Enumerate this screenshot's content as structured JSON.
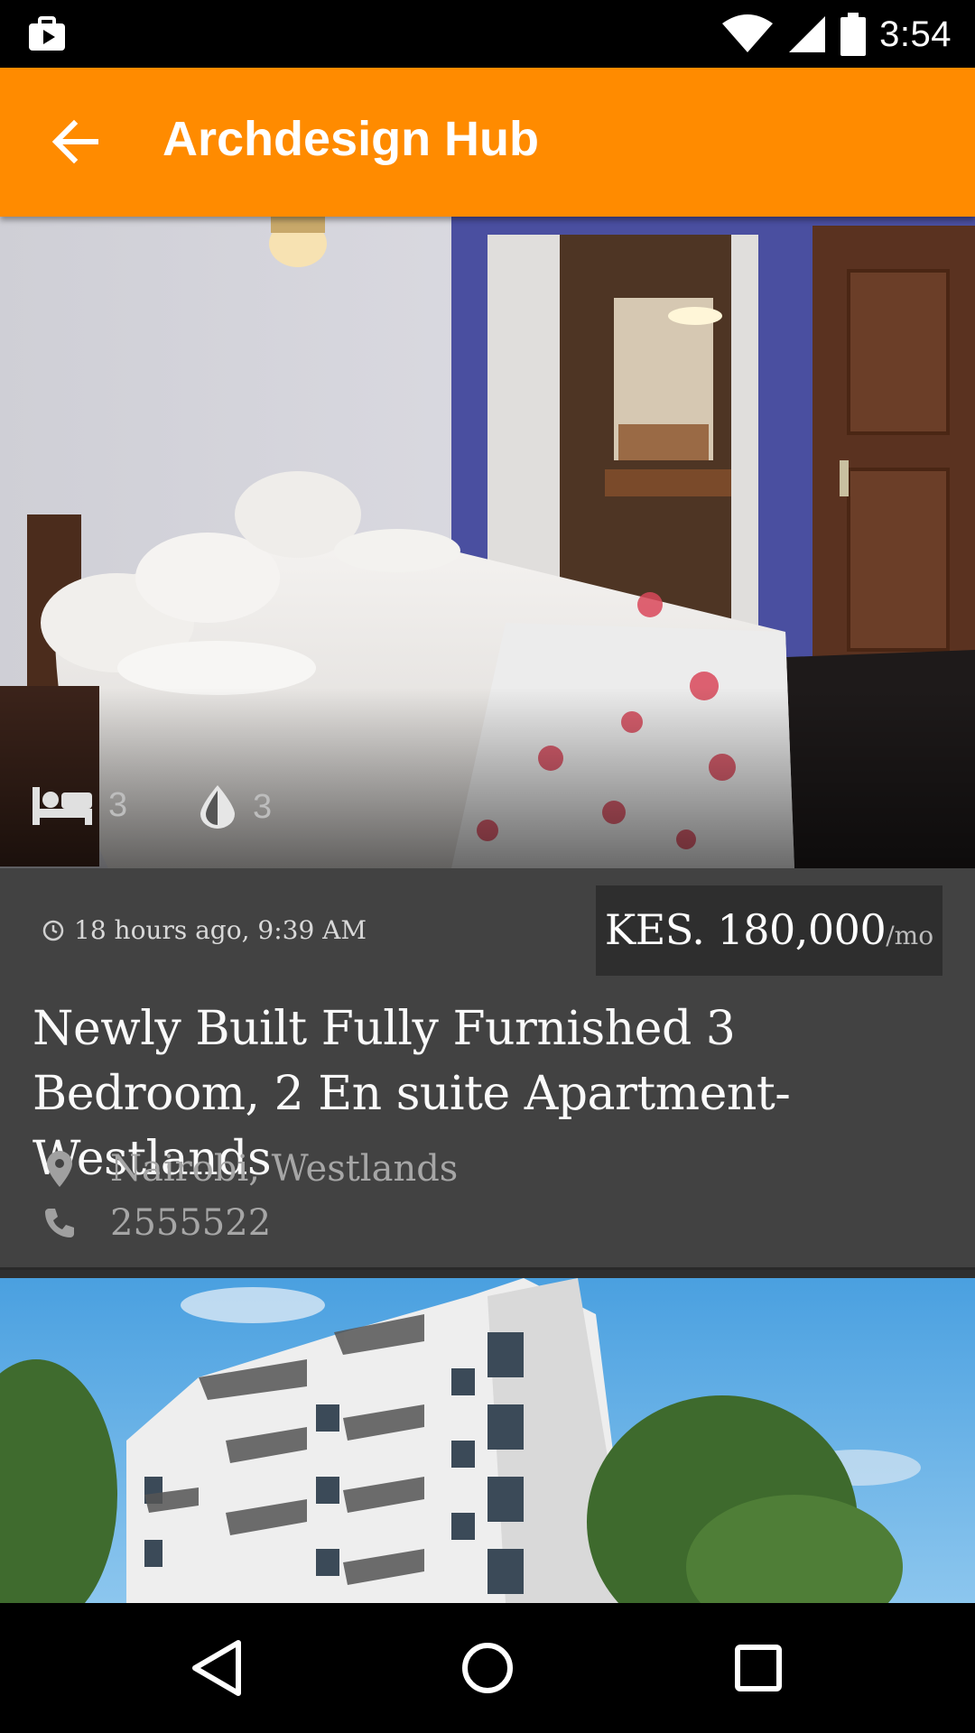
{
  "status_bar": {
    "time": "3:54",
    "icons": [
      "briefcase-play-icon",
      "wifi-icon",
      "cell-signal-icon",
      "battery-icon"
    ]
  },
  "app_bar": {
    "title": "Archdesign Hub",
    "back_icon": "arrow-back-icon",
    "color": "#ff8b00"
  },
  "listings": [
    {
      "bedrooms": "3",
      "bathrooms": "3",
      "posted": "18 hours ago, 9:39 AM",
      "price": "KES. 180,000",
      "price_period": "/mo",
      "title": "Newly Built Fully Furnished 3 Bedroom, 2 En suite Apartment-Westlands",
      "location": "Nairobi, Westlands",
      "phone": "2555522"
    }
  ],
  "nav_bar": {
    "icons": [
      "back-triangle-icon",
      "home-circle-icon",
      "recents-square-icon"
    ]
  }
}
